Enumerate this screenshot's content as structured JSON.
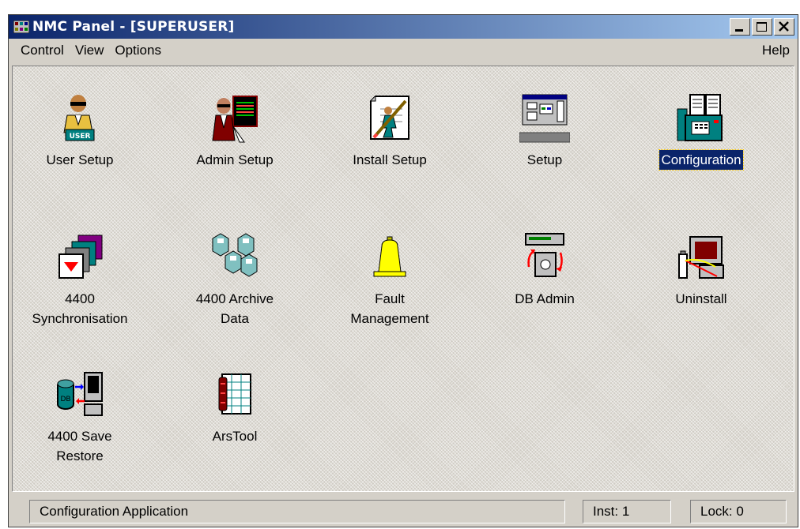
{
  "window": {
    "title": "NMC Panel - [SUPERUSER]"
  },
  "menu": {
    "items": [
      "Control",
      "View",
      "Options"
    ],
    "help": "Help"
  },
  "tiles": [
    {
      "label": "User Setup",
      "icon": "user-setup-icon",
      "selected": false
    },
    {
      "label": "Admin Setup",
      "icon": "admin-setup-icon",
      "selected": false
    },
    {
      "label": "Install Setup",
      "icon": "install-setup-icon",
      "selected": false
    },
    {
      "label": "Setup",
      "icon": "setup-icon",
      "selected": false
    },
    {
      "label": "Configuration",
      "icon": "configuration-icon",
      "selected": true
    },
    {
      "label": "4400\nSynchronisation",
      "icon": "synchronisation-icon",
      "selected": false
    },
    {
      "label": "4400 Archive\nData",
      "icon": "archive-data-icon",
      "selected": false
    },
    {
      "label": "Fault\nManagement",
      "icon": "fault-bell-icon",
      "selected": false
    },
    {
      "label": "DB Admin",
      "icon": "db-admin-icon",
      "selected": false
    },
    {
      "label": "Uninstall",
      "icon": "uninstall-icon",
      "selected": false
    },
    {
      "label": "4400 Save\nRestore",
      "icon": "save-restore-icon",
      "selected": false
    },
    {
      "label": "ArsTool",
      "icon": "arstool-icon",
      "selected": false
    }
  ],
  "status": {
    "message": "Configuration Application",
    "inst": "Inst: 1",
    "lock": "Lock: 0"
  },
  "colors": {
    "titlebar_start": "#0a246a",
    "titlebar_end": "#a6caf0",
    "selection": "#0a246a",
    "window_face": "#d4d0c8"
  }
}
